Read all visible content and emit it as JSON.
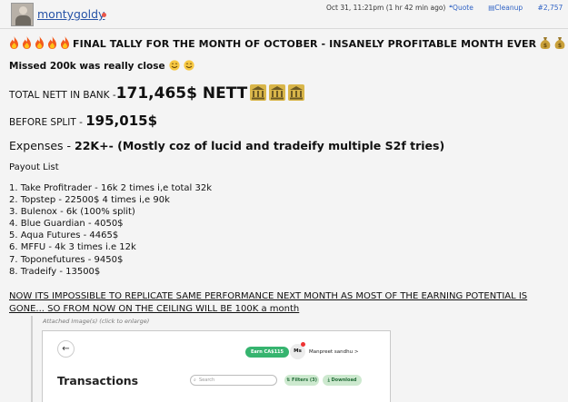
{
  "header": {
    "username": "montygoldy",
    "post_time": "Oct 31, 11:21pm (1 hr 42 min ago)",
    "actions": {
      "quote": "Quote",
      "cleanup": "Cleanup",
      "post_number": "#2,757"
    }
  },
  "post": {
    "headline": "FINAL TALLY FOR THE MONTH OF OCTOBER - INSANELY PROFITABLE MONTH EVER",
    "missed": "Missed 200k was really close",
    "nett_label": "TOTAL NETT IN BANK -",
    "nett_value": "171,465$ NETT",
    "split_label": "BEFORE SPLIT -",
    "split_value": "195,015$",
    "expenses_label": "Expenses -",
    "expenses_value": "22K+- (Mostly coz of lucid and tradeify multiple S2f tries)",
    "payout_heading": "Payout List",
    "payouts": [
      "1. Take Profitrader - 16k 2 times i,e total 32k",
      "2. Topstep - 22500$ 4 times i,e 90k",
      "3. Bulenox - 6k (100% split)",
      "4. Blue Guardian - 4050$",
      "5. Aqua Futures - 4465$",
      "6. MFFU - 4k 3 times i.e 12k",
      "7. Toponefutures - 9450$",
      "8. Tradeify - 13500$"
    ],
    "warning": "NOW ITS IMPOSSIBLE TO REPLICATE SAME PERFORMANCE NEXT MONTH AS MOST OF THE EARNING POTENTIAL IS GONE... SO FROM NOW ON THE CEILING WILL BE 100K a month",
    "attachment_caption": "Attached Image(s) (click to enlarge)"
  },
  "attachment_screenshot": {
    "back_glyph": "←",
    "earn_label": "Earn CA$115",
    "avatar_initials": "Ms",
    "user_name": "Manpreet sandhu  >",
    "title": "Transactions",
    "search_placeholder": "Search",
    "filters_label": "Filters (3)",
    "download_label": "Download"
  },
  "icons": [
    "fire-icon",
    "money-bag-icon",
    "smile-icon",
    "bank-icon"
  ],
  "colors": {
    "link": "#2753a7",
    "accent_green": "#36b46f",
    "fire": "#f25a1d",
    "moneybag": "#c9a03a"
  }
}
